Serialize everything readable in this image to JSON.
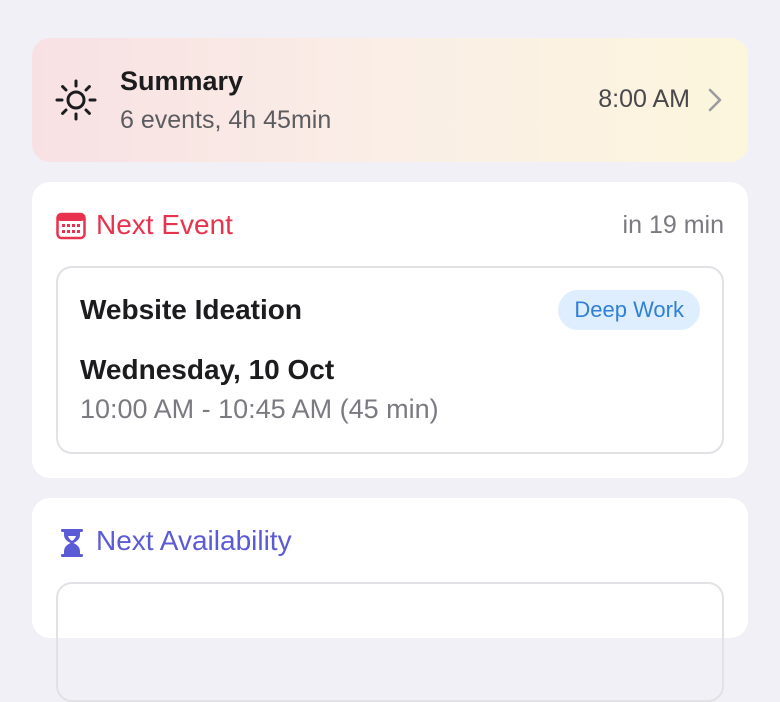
{
  "summary": {
    "title": "Summary",
    "subtitle": "6 events, 4h 45min",
    "time": "8:00 AM",
    "icon": "sun-icon"
  },
  "next_event": {
    "label": "Next Event",
    "countdown": "in 19 min",
    "icon": "calendar-icon",
    "accent_color": "#e8324e",
    "event": {
      "title": "Website Ideation",
      "tag": "Deep Work",
      "date": "Wednesday, 10 Oct",
      "time_range": "10:00 AM - 10:45 AM (45 min)"
    }
  },
  "next_availability": {
    "label": "Next Availability",
    "icon": "hourglass-icon",
    "accent_color": "#5b5bd6"
  }
}
